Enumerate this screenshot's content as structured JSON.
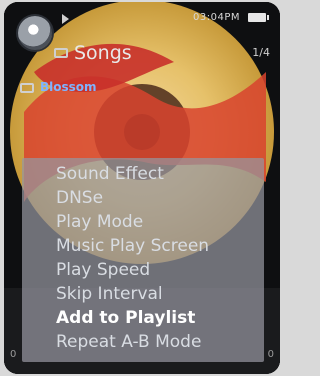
{
  "status_bar": {
    "clock": "03:04PM"
  },
  "header": {
    "title": "Songs",
    "counter": "1/4"
  },
  "now_playing": {
    "artist": "Blossom"
  },
  "menu": {
    "items": [
      {
        "label": "Sound Effect"
      },
      {
        "label": "DNSe"
      },
      {
        "label": "Play Mode"
      },
      {
        "label": "Music Play Screen"
      },
      {
        "label": "Play Speed"
      },
      {
        "label": "Skip Interval"
      },
      {
        "label": "Add to Playlist",
        "selected": true
      },
      {
        "label": "Repeat A-B Mode"
      }
    ]
  },
  "progress": {
    "start": "0",
    "end": "0"
  },
  "colors": {
    "menu_bg": "#9696a0",
    "selected_text": "#ffffff",
    "menu_text": "#d9dde3",
    "artist_text": "#7fb3ff"
  },
  "icons": [
    "app-icon",
    "play-indicator-icon",
    "battery-icon",
    "folder-icon",
    "note-icon"
  ]
}
